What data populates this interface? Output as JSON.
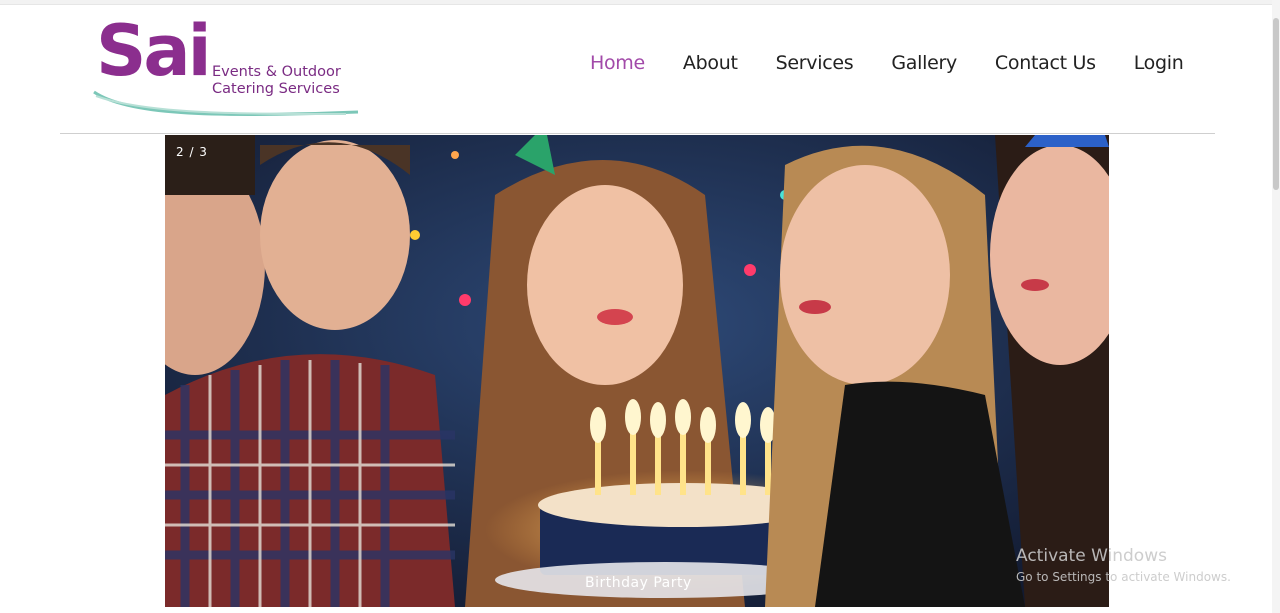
{
  "header": {
    "logo": {
      "wordmark": "Sai",
      "line1": "Events & Outdoor",
      "line2": "Catering Services",
      "brand_color": "#8b2e8e"
    },
    "nav": [
      {
        "label": "Home",
        "active": true
      },
      {
        "label": "About",
        "active": false
      },
      {
        "label": "Services",
        "active": false
      },
      {
        "label": "Gallery",
        "active": false
      },
      {
        "label": "Contact Us",
        "active": false
      },
      {
        "label": "Login",
        "active": false
      }
    ],
    "active_color": "#a24aa9"
  },
  "slider": {
    "counter": "2 / 3",
    "caption": "Birthday Party"
  },
  "system": {
    "watermark_line1": "Activate Windows",
    "watermark_line2": "Go to Settings to activate Windows."
  }
}
